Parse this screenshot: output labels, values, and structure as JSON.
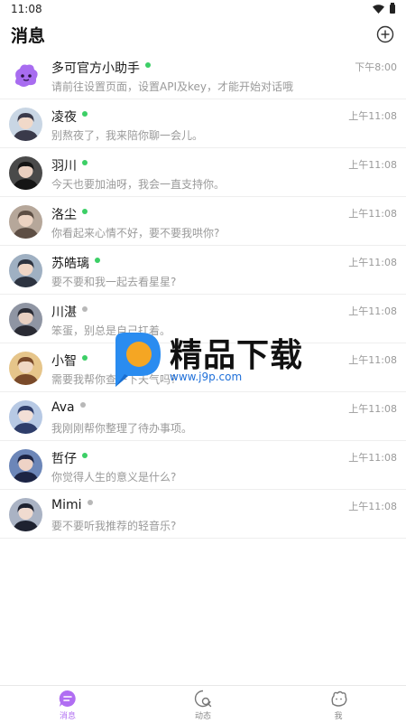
{
  "status_bar": {
    "time": "11:08"
  },
  "header": {
    "title": "消息"
  },
  "colors": {
    "accent": "#b06df2",
    "online": "#3ccf66",
    "offline": "#b8b8b8"
  },
  "conversations": [
    {
      "name": "多可官方小助手",
      "time": "下午8:00",
      "preview": "请前往设置页面，设置API及key，才能开始对话哦",
      "online": true,
      "avatar": "mascot-avatar"
    },
    {
      "name": "凌夜",
      "time": "上午11:08",
      "preview": "别熬夜了，我来陪你聊一会儿。",
      "online": true,
      "avatar": "character-avatar"
    },
    {
      "name": "羽川",
      "time": "上午11:08",
      "preview": "今天也要加油呀，我会一直支持你。",
      "online": true,
      "avatar": "character-avatar"
    },
    {
      "name": "洛尘",
      "time": "上午11:08",
      "preview": "你看起来心情不好，要不要我哄你?",
      "online": true,
      "avatar": "character-avatar"
    },
    {
      "name": "苏皓璃",
      "time": "上午11:08",
      "preview": "要不要和我一起去看星星?",
      "online": true,
      "avatar": "character-avatar"
    },
    {
      "name": "川湛",
      "time": "上午11:08",
      "preview": "笨蛋，别总是自己扛着。",
      "online": false,
      "avatar": "character-avatar"
    },
    {
      "name": "小智",
      "time": "上午11:08",
      "preview": "需要我帮你查一下天气吗?",
      "online": true,
      "avatar": "character-avatar"
    },
    {
      "name": "Ava",
      "time": "上午11:08",
      "preview": "我刚刚帮你整理了待办事项。",
      "online": false,
      "avatar": "character-avatar"
    },
    {
      "name": "哲仔",
      "time": "上午11:08",
      "preview": "你觉得人生的意义是什么?",
      "online": true,
      "avatar": "character-avatar"
    },
    {
      "name": "Mimi",
      "time": "上午11:08",
      "preview": "要不要听我推荐的轻音乐?",
      "online": false,
      "avatar": "character-avatar"
    }
  ],
  "watermark": {
    "text": "精品下载",
    "url": "www.j9p.com"
  },
  "bottom_nav": [
    {
      "label": "消息",
      "icon": "chat-bubble-icon",
      "active": true
    },
    {
      "label": "动态",
      "icon": "moments-icon",
      "active": false
    },
    {
      "label": "我",
      "icon": "profile-icon",
      "active": false
    }
  ]
}
